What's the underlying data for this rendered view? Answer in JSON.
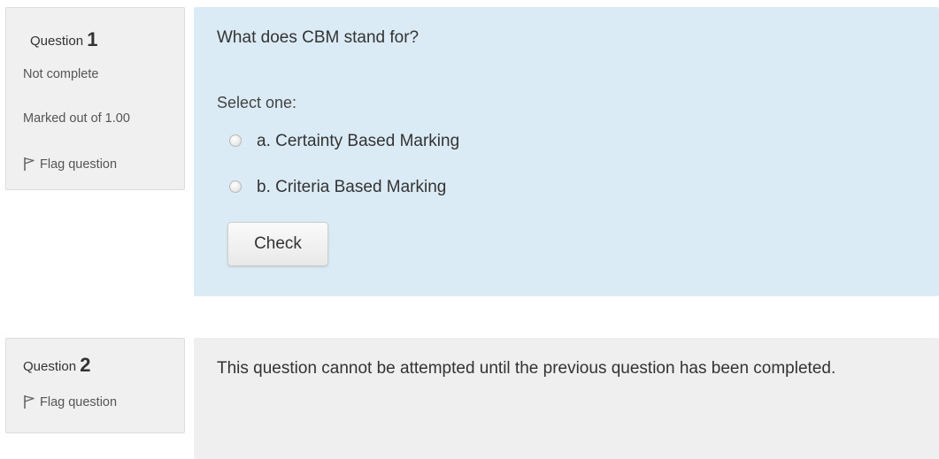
{
  "questions": [
    {
      "label": "Question",
      "number": "1",
      "state": "Not complete",
      "grade": "Marked out of 1.00",
      "flag_label": "Flag question",
      "text": "What does CBM stand for?",
      "prompt": "Select one:",
      "answers": [
        "a. Certainty Based Marking",
        "b. Criteria Based Marking"
      ],
      "check_label": "Check"
    },
    {
      "label": "Question",
      "number": "2",
      "flag_label": "Flag question",
      "blocked_text": "This question cannot be attempted until the previous question has been completed."
    }
  ],
  "colors": {
    "info_bg": "#f0f0f0",
    "q1_content_bg": "#dbebf5",
    "q2_content_bg": "#efefef"
  },
  "icons": {
    "flag": "flag-icon",
    "radio": "radio-unchecked"
  }
}
